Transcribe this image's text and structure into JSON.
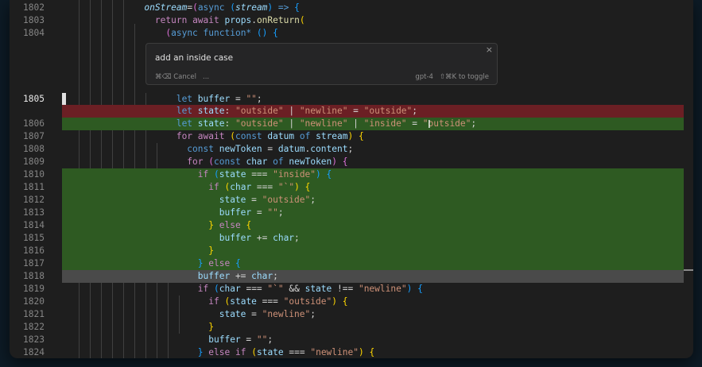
{
  "prompt": {
    "input_value": "add an inside case",
    "cancel": "⌘⌫ Cancel",
    "more": "...",
    "model": "gpt-4",
    "toggle_hint": "⇧⌘K to toggle",
    "close_glyph": "×"
  },
  "cursor_glyph": "I",
  "lines": [
    {
      "num": "1802",
      "tokens": [
        [
          "      ",
          ""
        ],
        [
          "onStream",
          "var it"
        ],
        [
          "=",
          ""
        ],
        [
          "(",
          "br2"
        ],
        [
          "async",
          "kw2"
        ],
        [
          " ",
          ""
        ],
        [
          "(",
          "br3"
        ],
        [
          "stream",
          "var it"
        ],
        [
          ")",
          "br3"
        ],
        [
          " => ",
          "kw2"
        ],
        [
          "{",
          "br3"
        ]
      ]
    },
    {
      "num": "1803",
      "tokens": [
        [
          "        ",
          ""
        ],
        [
          "return",
          "kw"
        ],
        [
          " ",
          ""
        ],
        [
          "await",
          "kw"
        ],
        [
          " ",
          ""
        ],
        [
          "props",
          "var"
        ],
        [
          ".",
          ""
        ],
        [
          "onReturn",
          "fn"
        ],
        [
          "(",
          "br1"
        ]
      ]
    },
    {
      "num": "1804",
      "tokens": [
        [
          "          ",
          ""
        ],
        [
          "(",
          "br2"
        ],
        [
          "async",
          "kw2"
        ],
        [
          " ",
          ""
        ],
        [
          "function*",
          "kw2"
        ],
        [
          " ",
          ""
        ],
        [
          "()",
          "br3"
        ],
        [
          " ",
          ""
        ],
        [
          "{",
          "br3"
        ]
      ]
    },
    {
      "num": "1805",
      "current": true,
      "tokens": [
        [
          "            ",
          ""
        ],
        [
          "let",
          "kw2"
        ],
        [
          " ",
          ""
        ],
        [
          "buffer",
          "var"
        ],
        [
          " = ",
          ""
        ],
        [
          "\"\"",
          "str"
        ],
        [
          ";",
          ""
        ]
      ]
    },
    {
      "num": "",
      "bg": "removed",
      "tokens": [
        [
          "            ",
          ""
        ],
        [
          "let",
          "kw2"
        ],
        [
          " ",
          ""
        ],
        [
          "state",
          "var"
        ],
        [
          ": ",
          ""
        ],
        [
          "\"outside\"",
          "str"
        ],
        [
          " | ",
          ""
        ],
        [
          "\"newline\"",
          "str"
        ],
        [
          " = ",
          ""
        ],
        [
          "\"outside\"",
          "str"
        ],
        [
          ";",
          ""
        ]
      ]
    },
    {
      "num": "1806",
      "bg": "added",
      "tokens": [
        [
          "            ",
          ""
        ],
        [
          "let",
          "kw2"
        ],
        [
          " ",
          ""
        ],
        [
          "state",
          "var"
        ],
        [
          ": ",
          ""
        ],
        [
          "\"outside\"",
          "str"
        ],
        [
          " | ",
          ""
        ],
        [
          "\"newline\"",
          "str"
        ],
        [
          " | ",
          ""
        ],
        [
          "\"inside\"",
          "str"
        ],
        [
          " = ",
          ""
        ],
        [
          "\"outside\"",
          "str"
        ],
        [
          ";",
          ""
        ]
      ]
    },
    {
      "num": "1807",
      "tokens": [
        [
          "            ",
          ""
        ],
        [
          "for",
          "kw"
        ],
        [
          " ",
          ""
        ],
        [
          "await",
          "kw"
        ],
        [
          " ",
          ""
        ],
        [
          "(",
          "br1"
        ],
        [
          "const",
          "kw2"
        ],
        [
          " ",
          ""
        ],
        [
          "datum",
          "var"
        ],
        [
          " ",
          ""
        ],
        [
          "of",
          "kw2"
        ],
        [
          " ",
          ""
        ],
        [
          "stream",
          "var"
        ],
        [
          ")",
          "br1"
        ],
        [
          " ",
          ""
        ],
        [
          "{",
          "br1"
        ]
      ]
    },
    {
      "num": "1808",
      "tokens": [
        [
          "              ",
          ""
        ],
        [
          "const",
          "kw2"
        ],
        [
          " ",
          ""
        ],
        [
          "newToken",
          "var"
        ],
        [
          " = ",
          ""
        ],
        [
          "datum",
          "var"
        ],
        [
          ".",
          ""
        ],
        [
          "content",
          "var"
        ],
        [
          ";",
          ""
        ]
      ]
    },
    {
      "num": "1809",
      "tokens": [
        [
          "              ",
          ""
        ],
        [
          "for",
          "kw"
        ],
        [
          " ",
          ""
        ],
        [
          "(",
          "br2"
        ],
        [
          "const",
          "kw2"
        ],
        [
          " ",
          ""
        ],
        [
          "char",
          "var"
        ],
        [
          " ",
          ""
        ],
        [
          "of",
          "kw2"
        ],
        [
          " ",
          ""
        ],
        [
          "newToken",
          "var"
        ],
        [
          ")",
          "br2"
        ],
        [
          " ",
          ""
        ],
        [
          "{",
          "br2"
        ]
      ]
    },
    {
      "num": "1810",
      "bg": "added",
      "tokens": [
        [
          "                ",
          ""
        ],
        [
          "if",
          "kw"
        ],
        [
          " ",
          ""
        ],
        [
          "(",
          "br3"
        ],
        [
          "state",
          "var"
        ],
        [
          " === ",
          ""
        ],
        [
          "\"inside\"",
          "str"
        ],
        [
          ")",
          "br3"
        ],
        [
          " ",
          ""
        ],
        [
          "{",
          "br3"
        ]
      ]
    },
    {
      "num": "1811",
      "bg": "added",
      "tokens": [
        [
          "                  ",
          ""
        ],
        [
          "if",
          "kw"
        ],
        [
          " ",
          ""
        ],
        [
          "(",
          "br1"
        ],
        [
          "char",
          "var"
        ],
        [
          " === ",
          ""
        ],
        [
          "\"`\"",
          "str"
        ],
        [
          ")",
          "br1"
        ],
        [
          " ",
          ""
        ],
        [
          "{",
          "br1"
        ]
      ]
    },
    {
      "num": "1812",
      "bg": "added",
      "tokens": [
        [
          "                    ",
          ""
        ],
        [
          "state",
          "var"
        ],
        [
          " = ",
          ""
        ],
        [
          "\"outside\"",
          "str"
        ],
        [
          ";",
          ""
        ]
      ]
    },
    {
      "num": "1813",
      "bg": "added",
      "tokens": [
        [
          "                    ",
          ""
        ],
        [
          "buffer",
          "var"
        ],
        [
          " = ",
          ""
        ],
        [
          "\"\"",
          "str"
        ],
        [
          ";",
          ""
        ]
      ]
    },
    {
      "num": "1814",
      "bg": "added",
      "tokens": [
        [
          "                  ",
          ""
        ],
        [
          "}",
          "br1"
        ],
        [
          " ",
          ""
        ],
        [
          "else",
          "kw"
        ],
        [
          " ",
          ""
        ],
        [
          "{",
          "br1"
        ]
      ]
    },
    {
      "num": "1815",
      "bg": "added",
      "tokens": [
        [
          "                    ",
          ""
        ],
        [
          "buffer",
          "var"
        ],
        [
          " += ",
          ""
        ],
        [
          "char",
          "var"
        ],
        [
          ";",
          ""
        ]
      ]
    },
    {
      "num": "1816",
      "bg": "added",
      "tokens": [
        [
          "                  ",
          ""
        ],
        [
          "}",
          "br1"
        ]
      ]
    },
    {
      "num": "1817",
      "bg": "added",
      "tokens": [
        [
          "                ",
          ""
        ],
        [
          "}",
          "br3"
        ],
        [
          " ",
          ""
        ],
        [
          "else",
          "kw"
        ],
        [
          " ",
          ""
        ],
        [
          "{",
          "br3"
        ]
      ]
    },
    {
      "num": "1818",
      "bg": "cursorline",
      "tokens": [
        [
          "                ",
          ""
        ],
        [
          "buffer",
          "var"
        ],
        [
          " += ",
          ""
        ],
        [
          "char",
          "var"
        ],
        [
          ";",
          ""
        ]
      ]
    },
    {
      "num": "1819",
      "tokens": [
        [
          "                ",
          ""
        ],
        [
          "if",
          "kw"
        ],
        [
          " ",
          ""
        ],
        [
          "(",
          "br3"
        ],
        [
          "char",
          "var"
        ],
        [
          " === ",
          ""
        ],
        [
          "\"`\"",
          "str"
        ],
        [
          " && ",
          ""
        ],
        [
          "state",
          "var"
        ],
        [
          " !== ",
          ""
        ],
        [
          "\"newline\"",
          "str"
        ],
        [
          ")",
          "br3"
        ],
        [
          " ",
          ""
        ],
        [
          "{",
          "br3"
        ]
      ]
    },
    {
      "num": "1820",
      "tokens": [
        [
          "                  ",
          ""
        ],
        [
          "if",
          "kw"
        ],
        [
          " ",
          ""
        ],
        [
          "(",
          "br1"
        ],
        [
          "state",
          "var"
        ],
        [
          " === ",
          ""
        ],
        [
          "\"outside\"",
          "str"
        ],
        [
          ")",
          "br1"
        ],
        [
          " ",
          ""
        ],
        [
          "{",
          "br1"
        ]
      ]
    },
    {
      "num": "1821",
      "tokens": [
        [
          "                    ",
          ""
        ],
        [
          "state",
          "var"
        ],
        [
          " = ",
          ""
        ],
        [
          "\"newline\"",
          "str"
        ],
        [
          ";",
          ""
        ]
      ]
    },
    {
      "num": "1822",
      "tokens": [
        [
          "                  ",
          ""
        ],
        [
          "}",
          "br1"
        ]
      ]
    },
    {
      "num": "1823",
      "tokens": [
        [
          "                  ",
          ""
        ],
        [
          "buffer",
          "var"
        ],
        [
          " = ",
          ""
        ],
        [
          "\"\"",
          "str"
        ],
        [
          ";",
          ""
        ]
      ]
    },
    {
      "num": "1824",
      "tokens": [
        [
          "                ",
          ""
        ],
        [
          "}",
          "br3"
        ],
        [
          " ",
          ""
        ],
        [
          "else",
          "kw"
        ],
        [
          " ",
          ""
        ],
        [
          "if",
          "kw"
        ],
        [
          " ",
          ""
        ],
        [
          "(",
          "br1"
        ],
        [
          "state",
          "var"
        ],
        [
          " === ",
          ""
        ],
        [
          "\"newline\"",
          "str"
        ],
        [
          ")",
          "br1"
        ],
        [
          " ",
          ""
        ],
        [
          "{",
          "br1"
        ]
      ]
    }
  ]
}
